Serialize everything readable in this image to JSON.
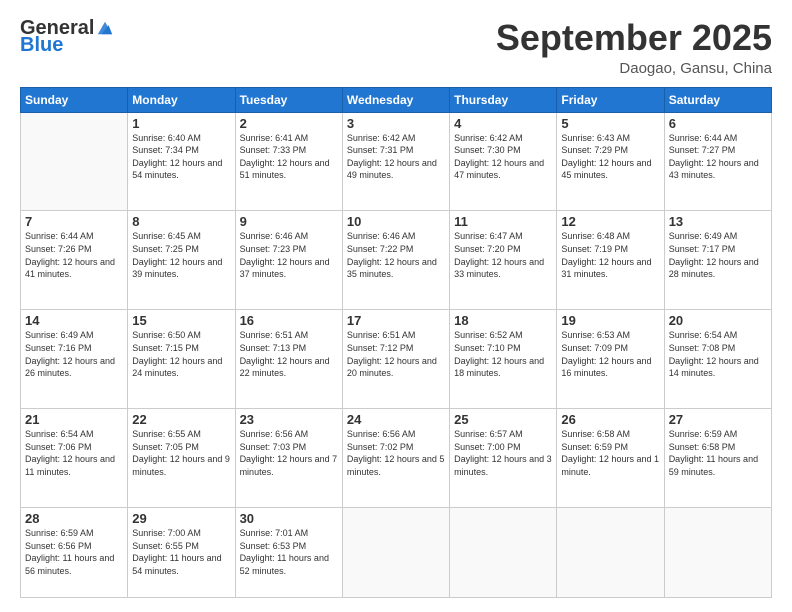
{
  "logo": {
    "general": "General",
    "blue": "Blue"
  },
  "header": {
    "month": "September 2025",
    "location": "Daogao, Gansu, China"
  },
  "weekdays": [
    "Sunday",
    "Monday",
    "Tuesday",
    "Wednesday",
    "Thursday",
    "Friday",
    "Saturday"
  ],
  "weeks": [
    [
      {
        "day": null
      },
      {
        "day": 1,
        "sunrise": "6:40 AM",
        "sunset": "7:34 PM",
        "daylight": "12 hours and 54 minutes."
      },
      {
        "day": 2,
        "sunrise": "6:41 AM",
        "sunset": "7:33 PM",
        "daylight": "12 hours and 51 minutes."
      },
      {
        "day": 3,
        "sunrise": "6:42 AM",
        "sunset": "7:31 PM",
        "daylight": "12 hours and 49 minutes."
      },
      {
        "day": 4,
        "sunrise": "6:42 AM",
        "sunset": "7:30 PM",
        "daylight": "12 hours and 47 minutes."
      },
      {
        "day": 5,
        "sunrise": "6:43 AM",
        "sunset": "7:29 PM",
        "daylight": "12 hours and 45 minutes."
      },
      {
        "day": 6,
        "sunrise": "6:44 AM",
        "sunset": "7:27 PM",
        "daylight": "12 hours and 43 minutes."
      }
    ],
    [
      {
        "day": 7,
        "sunrise": "6:44 AM",
        "sunset": "7:26 PM",
        "daylight": "12 hours and 41 minutes."
      },
      {
        "day": 8,
        "sunrise": "6:45 AM",
        "sunset": "7:25 PM",
        "daylight": "12 hours and 39 minutes."
      },
      {
        "day": 9,
        "sunrise": "6:46 AM",
        "sunset": "7:23 PM",
        "daylight": "12 hours and 37 minutes."
      },
      {
        "day": 10,
        "sunrise": "6:46 AM",
        "sunset": "7:22 PM",
        "daylight": "12 hours and 35 minutes."
      },
      {
        "day": 11,
        "sunrise": "6:47 AM",
        "sunset": "7:20 PM",
        "daylight": "12 hours and 33 minutes."
      },
      {
        "day": 12,
        "sunrise": "6:48 AM",
        "sunset": "7:19 PM",
        "daylight": "12 hours and 31 minutes."
      },
      {
        "day": 13,
        "sunrise": "6:49 AM",
        "sunset": "7:17 PM",
        "daylight": "12 hours and 28 minutes."
      }
    ],
    [
      {
        "day": 14,
        "sunrise": "6:49 AM",
        "sunset": "7:16 PM",
        "daylight": "12 hours and 26 minutes."
      },
      {
        "day": 15,
        "sunrise": "6:50 AM",
        "sunset": "7:15 PM",
        "daylight": "12 hours and 24 minutes."
      },
      {
        "day": 16,
        "sunrise": "6:51 AM",
        "sunset": "7:13 PM",
        "daylight": "12 hours and 22 minutes."
      },
      {
        "day": 17,
        "sunrise": "6:51 AM",
        "sunset": "7:12 PM",
        "daylight": "12 hours and 20 minutes."
      },
      {
        "day": 18,
        "sunrise": "6:52 AM",
        "sunset": "7:10 PM",
        "daylight": "12 hours and 18 minutes."
      },
      {
        "day": 19,
        "sunrise": "6:53 AM",
        "sunset": "7:09 PM",
        "daylight": "12 hours and 16 minutes."
      },
      {
        "day": 20,
        "sunrise": "6:54 AM",
        "sunset": "7:08 PM",
        "daylight": "12 hours and 14 minutes."
      }
    ],
    [
      {
        "day": 21,
        "sunrise": "6:54 AM",
        "sunset": "7:06 PM",
        "daylight": "12 hours and 11 minutes."
      },
      {
        "day": 22,
        "sunrise": "6:55 AM",
        "sunset": "7:05 PM",
        "daylight": "12 hours and 9 minutes."
      },
      {
        "day": 23,
        "sunrise": "6:56 AM",
        "sunset": "7:03 PM",
        "daylight": "12 hours and 7 minutes."
      },
      {
        "day": 24,
        "sunrise": "6:56 AM",
        "sunset": "7:02 PM",
        "daylight": "12 hours and 5 minutes."
      },
      {
        "day": 25,
        "sunrise": "6:57 AM",
        "sunset": "7:00 PM",
        "daylight": "12 hours and 3 minutes."
      },
      {
        "day": 26,
        "sunrise": "6:58 AM",
        "sunset": "6:59 PM",
        "daylight": "12 hours and 1 minute."
      },
      {
        "day": 27,
        "sunrise": "6:59 AM",
        "sunset": "6:58 PM",
        "daylight": "11 hours and 59 minutes."
      }
    ],
    [
      {
        "day": 28,
        "sunrise": "6:59 AM",
        "sunset": "6:56 PM",
        "daylight": "11 hours and 56 minutes."
      },
      {
        "day": 29,
        "sunrise": "7:00 AM",
        "sunset": "6:55 PM",
        "daylight": "11 hours and 54 minutes."
      },
      {
        "day": 30,
        "sunrise": "7:01 AM",
        "sunset": "6:53 PM",
        "daylight": "11 hours and 52 minutes."
      },
      {
        "day": null
      },
      {
        "day": null
      },
      {
        "day": null
      },
      {
        "day": null
      }
    ]
  ]
}
